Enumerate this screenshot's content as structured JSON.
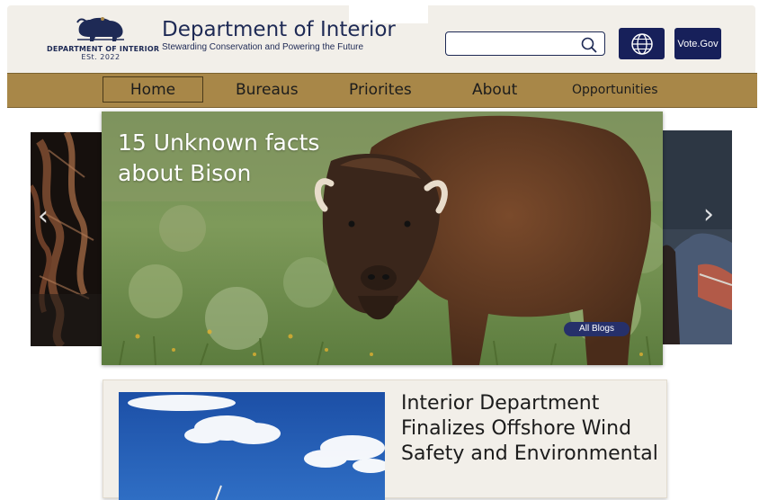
{
  "header": {
    "logo": {
      "name": "DEPARTMENT OF INTERIOR",
      "established": "ESt. 2022",
      "icon": "bison-icon"
    },
    "title": "Department of Interior",
    "tagline": "Stewarding Conservation and Powering the Future",
    "search": {
      "value": "",
      "icon": "search-icon"
    },
    "language_icon": "globe-icon",
    "vote_label": "Vote.Gov"
  },
  "nav": {
    "items": [
      "Home",
      "Bureaus",
      "Priorites",
      "About",
      "Opportunities"
    ],
    "active": "Home"
  },
  "carousel": {
    "hero_title": "15 Unknown facts about Bison",
    "button_label": "All Blogs",
    "prev_icon": "chevron-left-icon",
    "next_icon": "chevron-right-icon"
  },
  "news": {
    "headline": "Interior Department Finalizes Offshore Wind Safety and Environmental"
  },
  "colors": {
    "navy": "#17205a",
    "gold": "#a88748",
    "cream": "#f2efe9"
  }
}
